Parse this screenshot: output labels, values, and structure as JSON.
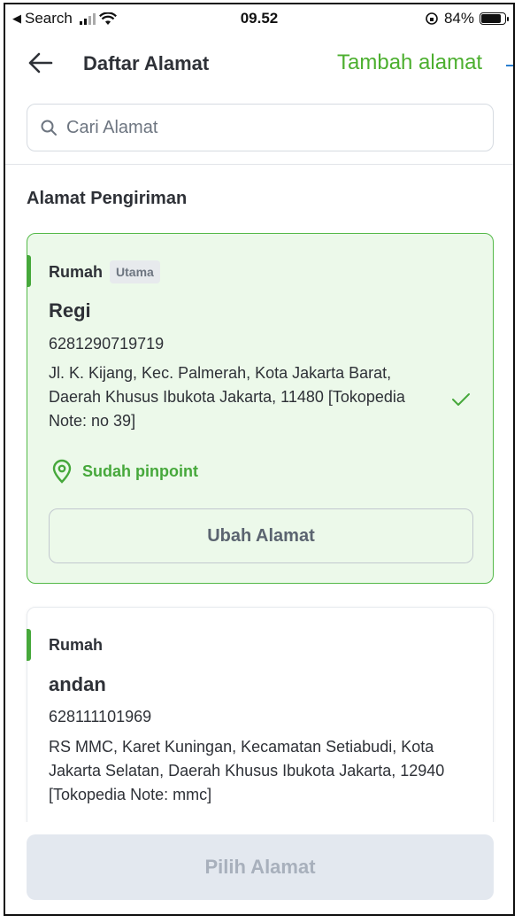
{
  "status_bar": {
    "back_app": "Search",
    "time": "09.52",
    "battery": "84%",
    "battery_level": 0.84
  },
  "header": {
    "title": "Daftar Alamat",
    "add_link": "Tambah alamat"
  },
  "search": {
    "placeholder": "Cari Alamat",
    "value": ""
  },
  "section_title": "Alamat Pengiriman",
  "addresses": [
    {
      "label": "Rumah",
      "badge": "Utama",
      "name": "Regi",
      "phone": "6281290719719",
      "address": "Jl. K. Kijang, Kec. Palmerah, Kota Jakarta Barat, Daerah Khusus Ibukota Jakarta, 11480 [Tokopedia Note: no 39]",
      "pinpoint": "Sudah pinpoint",
      "edit_button": "Ubah Alamat",
      "selected": true
    },
    {
      "label": "Rumah",
      "name": "andan",
      "phone": "628111101969",
      "address": "RS MMC, Karet Kuningan, Kecamatan Setiabudi, Kota Jakarta Selatan, Daerah Khusus Ibukota Jakarta, 12940 [Tokopedia Note: mmc]",
      "selected": false
    }
  ],
  "footer": {
    "confirm_button": "Pilih Alamat"
  },
  "colors": {
    "accent_green": "#4caf2f",
    "selected_bg": "#ecf9ea",
    "disabled_button": "#e3e8ef"
  },
  "icons": [
    "back-arrow-icon",
    "search-icon",
    "check-icon",
    "location-pin-icon",
    "signal-icon",
    "wifi-icon",
    "battery-icon"
  ]
}
